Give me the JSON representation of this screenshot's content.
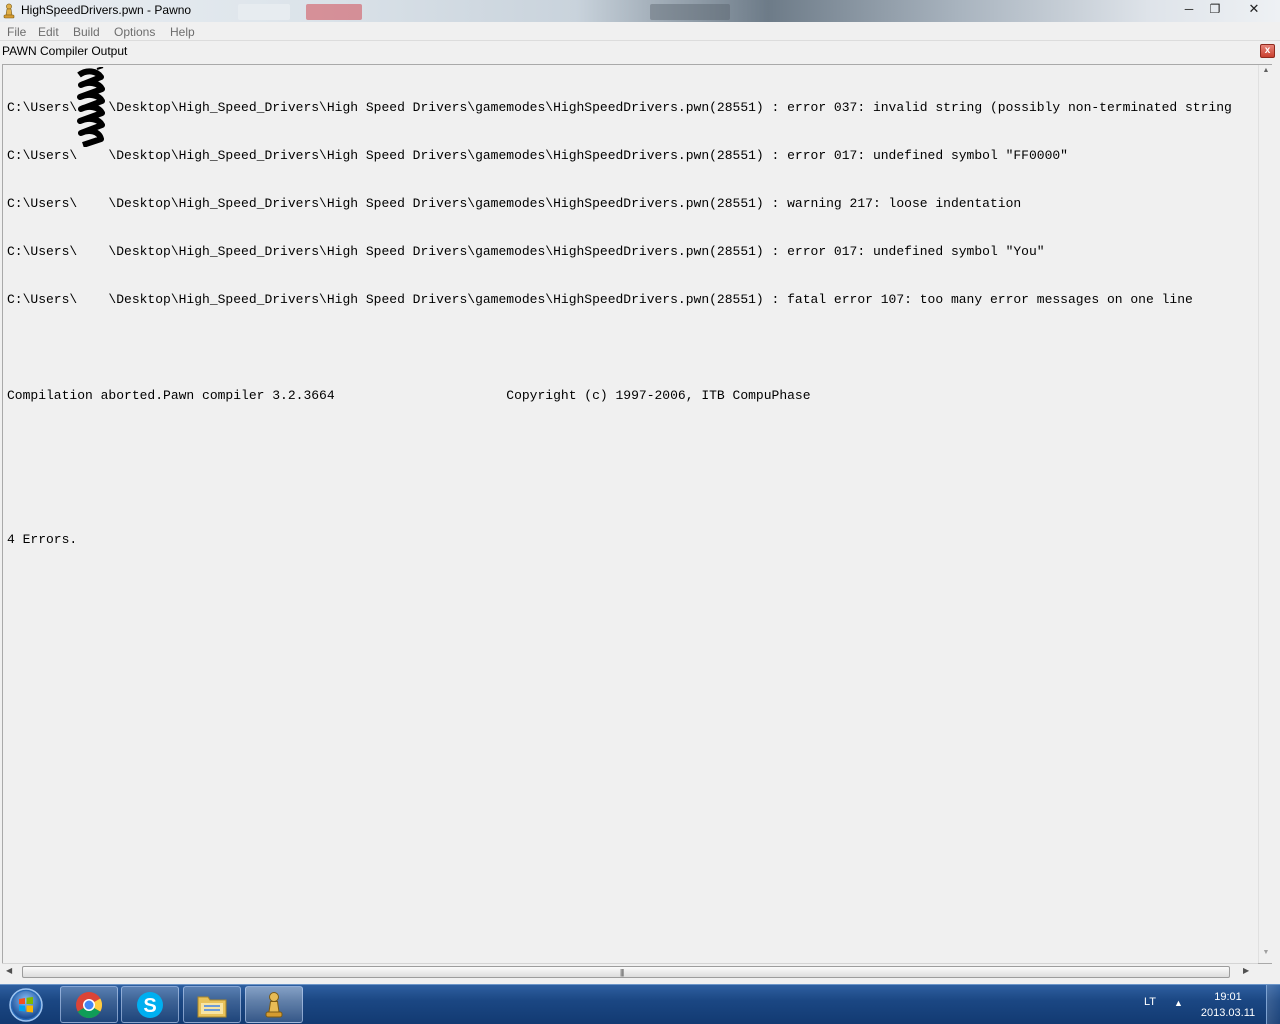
{
  "window": {
    "title": "HighSpeedDrivers.pwn - Pawno",
    "minimize_glyph": "─",
    "maximize_glyph": "❐",
    "close_glyph": "✕"
  },
  "menu": {
    "file": "File",
    "edit": "Edit",
    "build": "Build",
    "options": "Options",
    "help": "Help"
  },
  "panel": {
    "title": "PAWN Compiler Output",
    "close_glyph": "x"
  },
  "output": {
    "lines": [
      "C:\\Users\\    \\Desktop\\High_Speed_Drivers\\High Speed Drivers\\gamemodes\\HighSpeedDrivers.pwn(28551) : error 037: invalid string (possibly non-terminated string",
      "C:\\Users\\    \\Desktop\\High_Speed_Drivers\\High Speed Drivers\\gamemodes\\HighSpeedDrivers.pwn(28551) : error 017: undefined symbol \"FF0000\"",
      "C:\\Users\\    \\Desktop\\High_Speed_Drivers\\High Speed Drivers\\gamemodes\\HighSpeedDrivers.pwn(28551) : warning 217: loose indentation",
      "C:\\Users\\    \\Desktop\\High_Speed_Drivers\\High Speed Drivers\\gamemodes\\HighSpeedDrivers.pwn(28551) : error 017: undefined symbol \"You\"",
      "C:\\Users\\    \\Desktop\\High_Speed_Drivers\\High Speed Drivers\\gamemodes\\HighSpeedDrivers.pwn(28551) : fatal error 107: too many error messages on one line",
      "",
      "Compilation aborted.Pawn compiler 3.2.3664\t \t \tCopyright (c) 1997-2006, ITB CompuPhase",
      "",
      "",
      "4 Errors."
    ]
  },
  "scrollbars": {
    "up_glyph": "▲",
    "down_glyph": "▼",
    "left_glyph": "◀",
    "right_glyph": "▶",
    "grip_glyph": "|||"
  },
  "taskbar": {
    "apps": [
      "start-orb",
      "chrome",
      "skype",
      "file-explorer",
      "pawno"
    ],
    "tray_language": "LT",
    "tray_arrow_glyph": "▲",
    "clock_time": "19:01",
    "clock_date": "2013.03.11"
  },
  "colors": {
    "taskbar": "#1b4783",
    "output_background": "#f0f0f0",
    "close_button": "#c9402f"
  }
}
